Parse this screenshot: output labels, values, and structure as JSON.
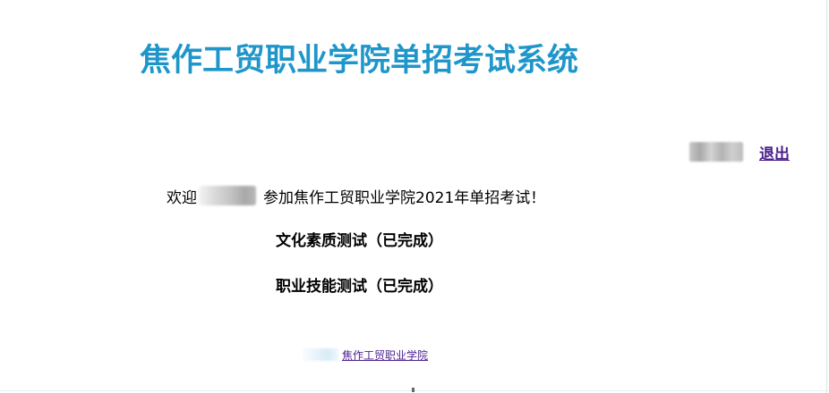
{
  "header": {
    "title": "焦作工贸职业学院单招考试系统"
  },
  "user_bar": {
    "logout_label": "退出"
  },
  "welcome": {
    "prefix": "欢迎",
    "suffix": "参加焦作工贸职业学院2021年单招考试！"
  },
  "tests": [
    {
      "label": "文化素质测试（已完成）"
    },
    {
      "label": "职业技能测试（已完成）"
    }
  ],
  "footer": {
    "link_text": "焦作工贸职业学院"
  },
  "colors": {
    "title": "#1f96c9",
    "link": "#4b1f8c"
  }
}
